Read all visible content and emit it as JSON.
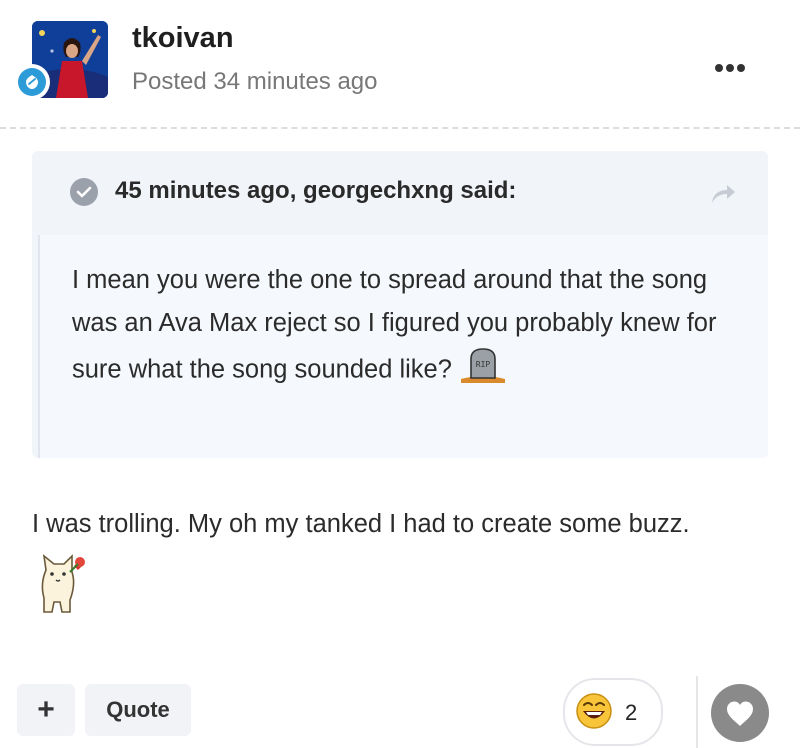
{
  "post": {
    "username": "tkoivan",
    "posted": "Posted 34 minutes ago",
    "icons": {
      "avatar": "user-avatar-photo",
      "badge": "member-badge-icon",
      "more": "more-options-icon"
    }
  },
  "quote": {
    "citation": "45 minutes ago, georgechxng said:",
    "text": "I mean you were the one to spread around that the song was an Ava Max reject so I figured you probably knew for sure what the song sounded like?",
    "icons": {
      "check": "check-circle-icon",
      "share": "share-arrow-icon",
      "emoji": "tombstone-rip-emoji"
    }
  },
  "body": {
    "text": "I was trolling. My oh my tanked I had to create some buzz.",
    "icons": {
      "emoji": "cat-flower-emoji"
    }
  },
  "footer": {
    "plus_label": "+",
    "quote_label": "Quote",
    "reaction_count": "2",
    "icons": {
      "reaction": "laughing-face-icon",
      "heart": "heart-icon"
    }
  },
  "colors": {
    "badge": "#2d9bd7",
    "quote_bg": "#f1f4f9",
    "muted": "#777777",
    "heart_bg": "#8a8a8a"
  }
}
